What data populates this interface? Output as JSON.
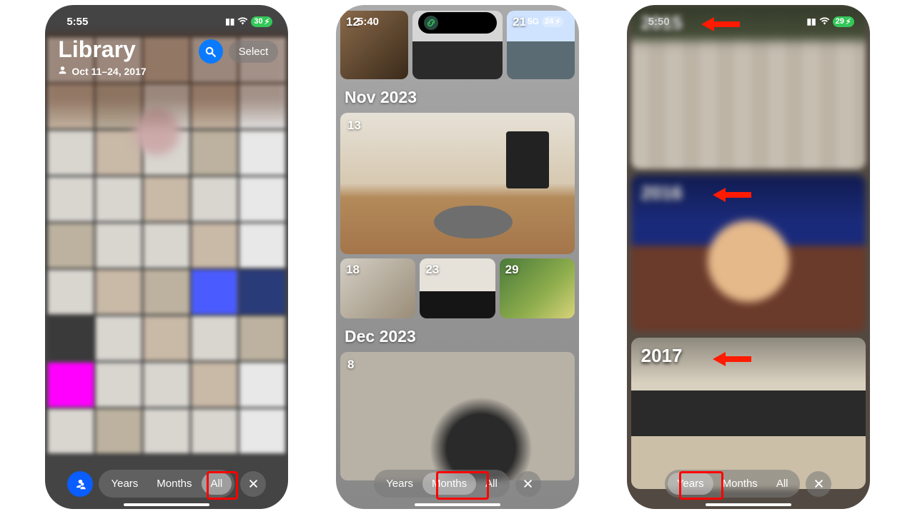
{
  "phone1": {
    "time": "5:55",
    "battery": "30",
    "title": "Library",
    "subtitle": "Oct 11–24, 2017",
    "search_label": "Search",
    "select_label": "Select",
    "segments": {
      "years": "Years",
      "months": "Months",
      "all": "All"
    },
    "active": "all"
  },
  "phone2": {
    "time": "5:40",
    "signal": "5G",
    "battery": "24",
    "top_days": [
      "12",
      "",
      "21"
    ],
    "month1": "Nov 2023",
    "month1_big_day": "13",
    "month1_row": [
      "18",
      "23",
      "29"
    ],
    "month2": "Dec 2023",
    "month2_big_day": "8",
    "segments": {
      "years": "Years",
      "months": "Months",
      "all": "All"
    },
    "active": "months"
  },
  "phone3": {
    "time": "5:50",
    "battery": "29",
    "years": [
      "2015",
      "2016",
      "2017"
    ],
    "segments": {
      "years": "Years",
      "months": "Months",
      "all": "All"
    },
    "active": "years"
  }
}
